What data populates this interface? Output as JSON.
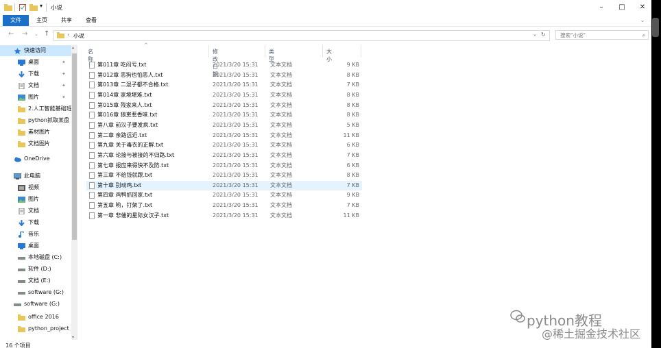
{
  "window": {
    "title": "小说",
    "buttons": {
      "minimize": "–",
      "maximize": "□",
      "close": "✕"
    }
  },
  "ribbon": {
    "tabs": [
      "文件",
      "主页",
      "共享",
      "查看"
    ]
  },
  "address": {
    "path": "小说",
    "search_placeholder": "搜索\"小说\""
  },
  "sidebar": {
    "items": [
      {
        "label": "快速访问",
        "icon": "star-icon",
        "indent": 0,
        "pinned": false
      },
      {
        "label": "桌面",
        "icon": "desktop-icon",
        "indent": 1,
        "pinned": true
      },
      {
        "label": "下载",
        "icon": "download-icon",
        "indent": 1,
        "pinned": true
      },
      {
        "label": "文档",
        "icon": "document-icon",
        "indent": 1,
        "pinned": true
      },
      {
        "label": "图片",
        "icon": "picture-icon",
        "indent": 1,
        "pinned": true
      },
      {
        "label": "2.人工智能基础班",
        "icon": "folder-icon",
        "indent": 1,
        "pinned": false
      },
      {
        "label": "python抓取某盘",
        "icon": "folder-icon",
        "indent": 1,
        "pinned": false
      },
      {
        "label": "素材图片",
        "icon": "folder-icon",
        "indent": 1,
        "pinned": false
      },
      {
        "label": "文档图片",
        "icon": "folder-icon",
        "indent": 1,
        "pinned": false
      },
      {
        "label": "OneDrive",
        "icon": "cloud-icon",
        "indent": 0,
        "pinned": false
      },
      {
        "label": "此电脑",
        "icon": "computer-icon",
        "indent": 0,
        "pinned": false
      },
      {
        "label": "视频",
        "icon": "video-icon",
        "indent": 1,
        "pinned": false
      },
      {
        "label": "图片",
        "icon": "picture-icon",
        "indent": 1,
        "pinned": false
      },
      {
        "label": "文档",
        "icon": "document-icon",
        "indent": 1,
        "pinned": false
      },
      {
        "label": "下载",
        "icon": "download-icon",
        "indent": 1,
        "pinned": false
      },
      {
        "label": "音乐",
        "icon": "music-icon",
        "indent": 1,
        "pinned": false
      },
      {
        "label": "桌面",
        "icon": "desktop-icon",
        "indent": 1,
        "pinned": false
      },
      {
        "label": "本地磁盘 (C:)",
        "icon": "drive-icon",
        "indent": 1,
        "pinned": false
      },
      {
        "label": "软件 (D:)",
        "icon": "drive-icon",
        "indent": 1,
        "pinned": false
      },
      {
        "label": "文档 (E:)",
        "icon": "drive-icon",
        "indent": 1,
        "pinned": false
      },
      {
        "label": "software (G:)",
        "icon": "drive-icon",
        "indent": 1,
        "pinned": false
      },
      {
        "label": "software (G:)",
        "icon": "drive-icon",
        "indent": 0,
        "pinned": false
      },
      {
        "label": "office 2016",
        "icon": "folder-icon",
        "indent": 1,
        "pinned": false
      },
      {
        "label": "python_project",
        "icon": "folder-icon",
        "indent": 1,
        "pinned": false
      }
    ]
  },
  "columns": {
    "name": "名称",
    "date": "修改日期",
    "type": "类型",
    "size": "大小"
  },
  "files": [
    {
      "name": "第011章 吃闷亏.txt",
      "date": "2021/3/20 15:31",
      "type": "文本文档",
      "size": "9 KB"
    },
    {
      "name": "第012章 恶狗也怕恶人.txt",
      "date": "2021/3/20 15:31",
      "type": "文本文档",
      "size": "8 KB"
    },
    {
      "name": "第013章 二混子都不合格.txt",
      "date": "2021/3/20 15:31",
      "type": "文本文档",
      "size": "7 KB"
    },
    {
      "name": "第014章 家境堪难.txt",
      "date": "2021/3/20 15:31",
      "type": "文本文档",
      "size": "8 KB"
    },
    {
      "name": "第015章 残家来人.txt",
      "date": "2021/3/20 15:31",
      "type": "文本文档",
      "size": "8 KB"
    },
    {
      "name": "第016章 狼崽惹香味.txt",
      "date": "2021/3/20 15:31",
      "type": "文本文档",
      "size": "8 KB"
    },
    {
      "name": "第八章 前汉子要发疯.txt",
      "date": "2021/3/20 15:31",
      "type": "文本文档",
      "size": "5 KB"
    },
    {
      "name": "第二章 亲路远近.txt",
      "date": "2021/3/20 15:31",
      "type": "文本文档",
      "size": "11 KB"
    },
    {
      "name": "第九章 关于毒衣的正解.txt",
      "date": "2021/3/20 15:31",
      "type": "文本文档",
      "size": "6 KB"
    },
    {
      "name": "第六章 论接与被接的不归路.txt",
      "date": "2021/3/20 15:31",
      "type": "文本文档",
      "size": "7 KB"
    },
    {
      "name": "第七章 报应来得快不及防.txt",
      "date": "2021/3/20 15:31",
      "type": "文本文档",
      "size": "6 KB"
    },
    {
      "name": "第三章 不给钱就跟.txt",
      "date": "2021/3/20 15:31",
      "type": "文本文档",
      "size": "8 KB"
    },
    {
      "name": "第十章 别动鸡.txt",
      "date": "2021/3/20 15:31",
      "type": "文本文档",
      "size": "7 KB",
      "selected": true
    },
    {
      "name": "第四章 鸡鸭抓回家.txt",
      "date": "2021/3/20 15:31",
      "type": "文本文档",
      "size": "9 KB"
    },
    {
      "name": "第五章 哟，打架了.txt",
      "date": "2021/3/20 15:31",
      "type": "文本文档",
      "size": "7 KB"
    },
    {
      "name": "第一章 悲催的星际女汉子.txt",
      "date": "2021/3/20 15:31",
      "type": "文本文档",
      "size": "11 KB"
    }
  ],
  "status": {
    "count": "16 个项目"
  },
  "watermark": {
    "line1": "python教程",
    "line2": "@稀土掘金技术社区"
  },
  "colors": {
    "accent": "#1a6fc8",
    "selected_row": "#e5f3ff"
  }
}
